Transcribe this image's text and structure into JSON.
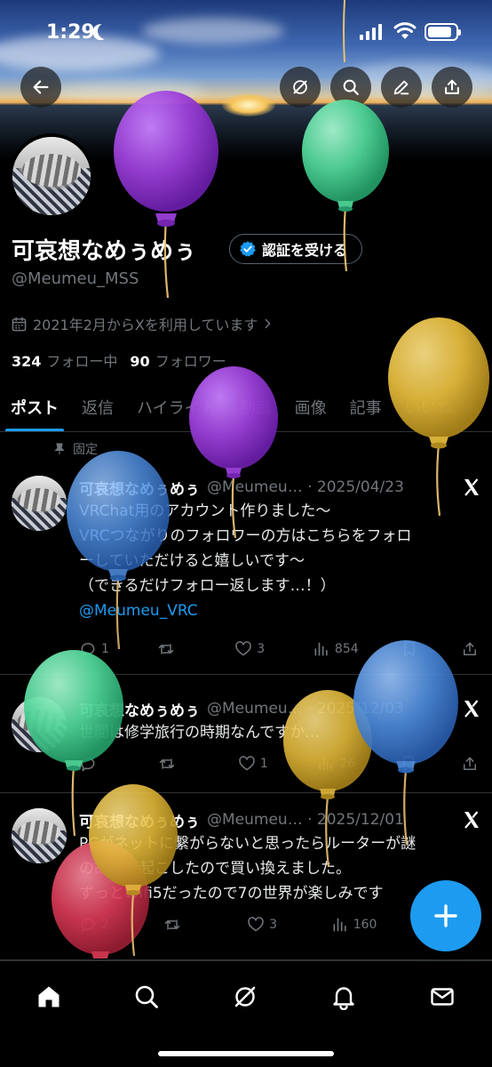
{
  "status_bar": {
    "time": "1:29"
  },
  "profile": {
    "display_name": "可哀想なめぅめぅ",
    "verify_label": "認証を受ける",
    "handle": "@Meumeu_MSS",
    "joined": "2021年2月からXを利用しています",
    "following_count": "324",
    "following_label": "フォロー中",
    "followers_count": "90",
    "followers_label": "フォロワー"
  },
  "tabs": [
    "ポスト",
    "返信",
    "ハイライト",
    "動画",
    "画像",
    "記事",
    "いいね"
  ],
  "pinned_label": "固定",
  "posts": [
    {
      "name": "可哀想なめぅめぅ",
      "meta": "@Meumeu… · 2025/04/23",
      "lines": [
        "VRChat用のアカウント作りました〜",
        "VRCつながりのフォロワーの方はこちらをフォロ",
        "ーしていただけると嬉しいです〜",
        "（できるだけフォロー返します…！）"
      ],
      "link": "@Meumeu_VRC",
      "replies": "1",
      "reposts": "",
      "likes": "3",
      "views": "854"
    },
    {
      "name": "可哀想なめぅめぅ",
      "meta": "@Meumeu… · 2025/12/03",
      "lines": [
        "世間は修学旅行の時期なんですか…"
      ],
      "replies": "",
      "reposts": "",
      "likes": "1",
      "views": "26"
    },
    {
      "name": "可哀想なめぅめぅ",
      "meta": "@Meumeu… · 2025/12/01",
      "lines": [
        "PCがネットに繋がらないと思ったらルーターが謎",
        "の故障を起こしたので買い換えました。",
        "ずっとWifi5だったので7の世界が楽しみです"
      ],
      "replies": "2",
      "reposts": "",
      "likes": "3",
      "views": "160"
    }
  ],
  "colors": {
    "accent": "#1d9bf0",
    "muted": "#71767b",
    "balloon_purple": "#9b3fd8",
    "balloon_green": "#4fd497",
    "balloon_yellow": "#e2b93b",
    "balloon_blue": "#4f8fe0",
    "balloon_red": "#d83a55"
  }
}
